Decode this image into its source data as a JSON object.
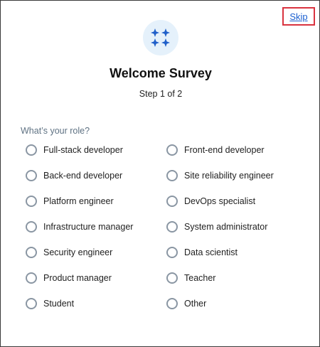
{
  "dialog": {
    "skip_label": "Skip",
    "icon": "sparkles-icon",
    "title": "Welcome Survey",
    "step_text": "Step 1 of 2",
    "question": "What’s your role?",
    "options": [
      {
        "label": "Full-stack developer",
        "selected": false
      },
      {
        "label": "Front-end developer",
        "selected": false
      },
      {
        "label": "Back-end developer",
        "selected": false
      },
      {
        "label": "Site reliability engineer",
        "selected": false
      },
      {
        "label": "Platform engineer",
        "selected": false
      },
      {
        "label": "DevOps specialist",
        "selected": false
      },
      {
        "label": "Infrastructure manager",
        "selected": false
      },
      {
        "label": "System administrator",
        "selected": false
      },
      {
        "label": "Security engineer",
        "selected": false
      },
      {
        "label": "Data scientist",
        "selected": false
      },
      {
        "label": "Product manager",
        "selected": false
      },
      {
        "label": "Teacher",
        "selected": false
      },
      {
        "label": "Student",
        "selected": false
      },
      {
        "label": "Other",
        "selected": false
      }
    ]
  },
  "colors": {
    "accent": "#1a5fd0",
    "icon_bg": "#e5f1fb",
    "highlight_border": "#d9333f",
    "radio_border": "#8a96a3",
    "question_text": "#5f7283"
  }
}
